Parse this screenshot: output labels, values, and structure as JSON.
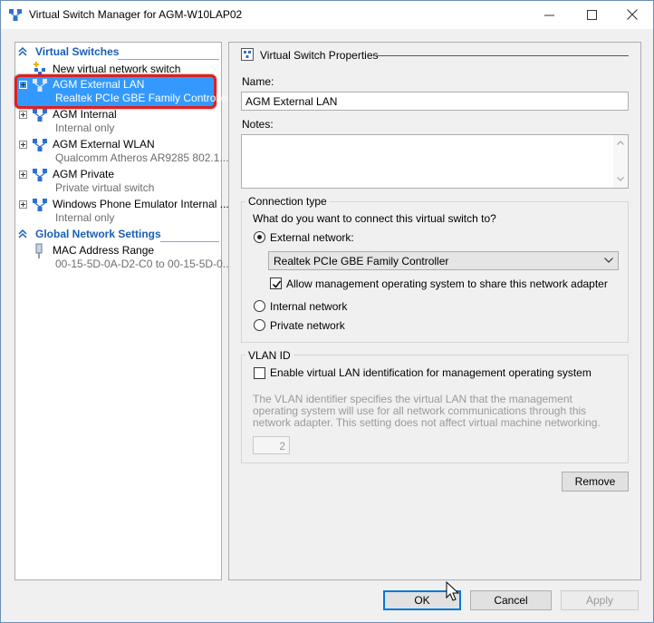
{
  "window": {
    "title": "Virtual Switch Manager for AGM-W10LAP02"
  },
  "tree": {
    "virtual_switches_header": "Virtual Switches",
    "new_switch_label": "New virtual network switch",
    "switches": [
      {
        "name": "AGM External LAN",
        "sub": "Realtek PCIe GBE Family Controller",
        "selected": true
      },
      {
        "name": "AGM Internal",
        "sub": "Internal only"
      },
      {
        "name": "AGM External WLAN",
        "sub": "Qualcomm Atheros AR9285 802.1..."
      },
      {
        "name": "AGM Private",
        "sub": "Private virtual switch"
      },
      {
        "name": "Windows Phone Emulator Internal ...",
        "sub": "Internal only"
      }
    ],
    "global_settings_header": "Global Network Settings",
    "mac_range": {
      "name": "MAC Address Range",
      "sub": "00-15-5D-0A-D2-C0 to 00-15-5D-0..."
    }
  },
  "props": {
    "section_title": "Virtual Switch Properties",
    "name_label": "Name:",
    "name_value": "AGM External LAN",
    "notes_label": "Notes:",
    "notes_value": "",
    "connection_type": {
      "label": "Connection type",
      "question": "What do you want to connect this virtual switch to?",
      "external_label": "External network:",
      "adapter_value": "Realtek PCIe GBE Family Controller",
      "allow_mgmt_label": "Allow management operating system to share this network adapter",
      "internal_label": "Internal network",
      "private_label": "Private network",
      "selected": "external",
      "allow_mgmt_checked": true
    },
    "vlan": {
      "label": "VLAN ID",
      "enable_label": "Enable virtual LAN identification for management operating system",
      "enable_checked": false,
      "description": "The VLAN identifier specifies the virtual LAN that the management operating system will use for all network communications through this network adapter. This setting does not affect virtual machine networking.",
      "id_value": "2"
    },
    "remove_label": "Remove"
  },
  "footer": {
    "ok_label": "OK",
    "cancel_label": "Cancel",
    "apply_label": "Apply"
  },
  "colors": {
    "accent": "#1a5fb4",
    "selection": "#3399ff",
    "highlight_border": "#e02020"
  }
}
